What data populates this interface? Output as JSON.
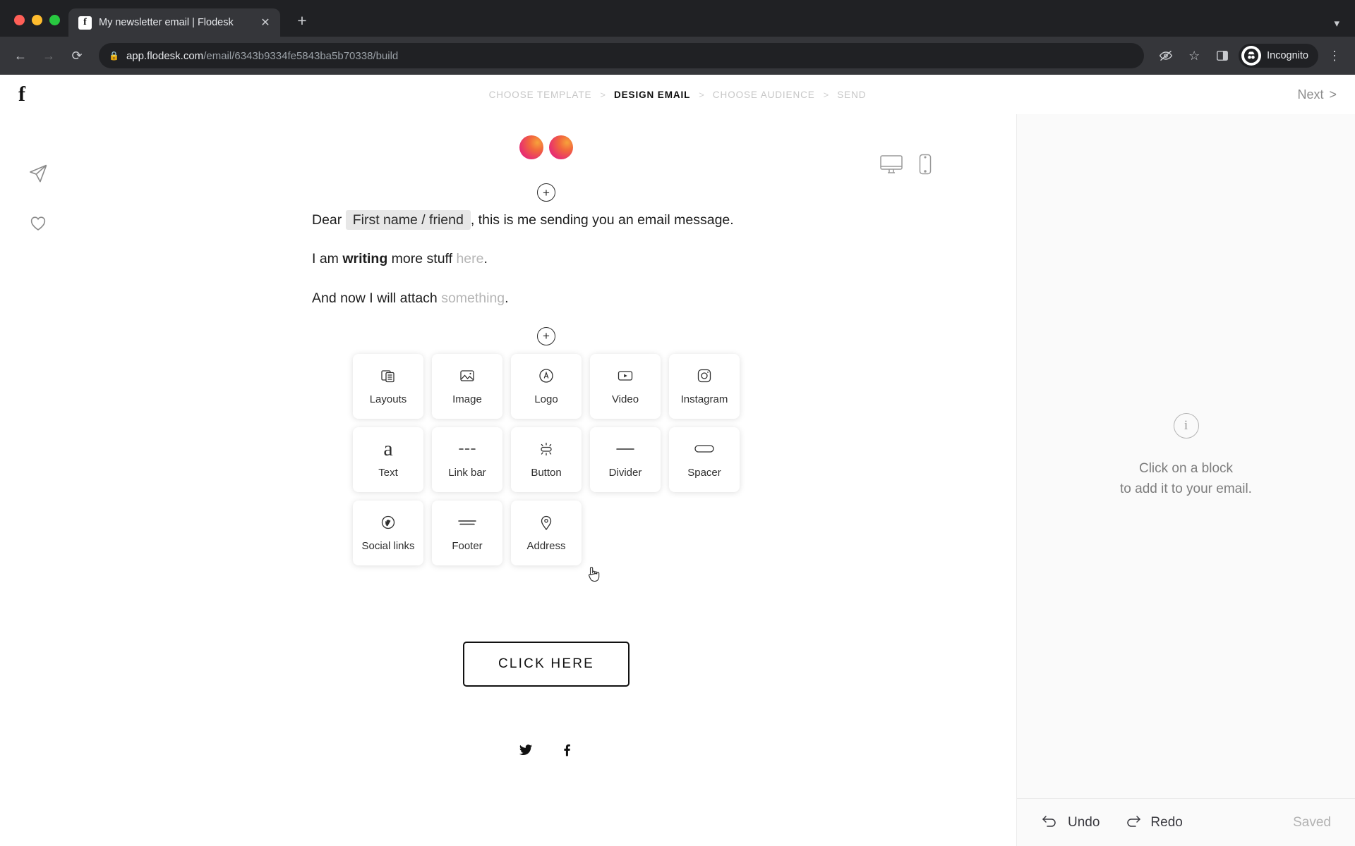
{
  "browser": {
    "tab": {
      "title": "My newsletter email | Flodesk",
      "favicon_letter": "f",
      "close_icon": "close-icon"
    },
    "new_tab_label": "+",
    "tab_list_chevron": "chevron-down-icon",
    "url_host": "app.flodesk.com",
    "url_path": "/email/6343b9334fe5843ba5b70338/build",
    "profile_label": "Incognito",
    "icons": {
      "back": "back-arrow-icon",
      "forward": "forward-arrow-icon",
      "reload": "reload-icon",
      "lock": "lock-icon",
      "tracking_protection": "eye-off-icon",
      "bookmark": "star-icon",
      "side_panel": "side-panel-icon",
      "menu": "three-dot-menu-icon"
    }
  },
  "app": {
    "brand_logo": "f",
    "steps": [
      {
        "label": "CHOOSE TEMPLATE",
        "active": false
      },
      {
        "label": "DESIGN EMAIL",
        "active": true
      },
      {
        "label": "CHOOSE AUDIENCE",
        "active": false
      },
      {
        "label": "SEND",
        "active": false
      }
    ],
    "step_separator": ">",
    "next_label": "Next",
    "next_chevron": ">",
    "left_rail": [
      {
        "name": "preview-send-icon"
      },
      {
        "name": "favorite-heart-icon"
      }
    ],
    "preview_toggles": [
      {
        "name": "desktop-preview-icon"
      },
      {
        "name": "mobile-preview-icon"
      }
    ]
  },
  "email": {
    "add_block_symbol": "+",
    "paragraph1": {
      "prefix": "Dear",
      "merge_tag": "First name / friend",
      "suffix": ", this is me sending you an email message."
    },
    "paragraph2": {
      "pre": "I am ",
      "bold": "writing",
      "mid": " more stuff ",
      "link": "here",
      "post": "."
    },
    "paragraph3": {
      "pre": "And now I will attach ",
      "link": "something",
      "post": "."
    },
    "cta_label": "CLICK HERE",
    "footer_social": [
      {
        "name": "twitter-icon"
      },
      {
        "name": "facebook-icon"
      }
    ]
  },
  "block_picker": {
    "rows": [
      [
        {
          "label": "Layouts",
          "icon": "layouts-icon"
        },
        {
          "label": "Image",
          "icon": "image-icon"
        },
        {
          "label": "Logo",
          "icon": "logo-icon"
        },
        {
          "label": "Video",
          "icon": "video-icon"
        },
        {
          "label": "Instagram",
          "icon": "instagram-icon"
        }
      ],
      [
        {
          "label": "Text",
          "icon": "text-icon"
        },
        {
          "label": "Link bar",
          "icon": "link-bar-icon"
        },
        {
          "label": "Button",
          "icon": "button-icon"
        },
        {
          "label": "Divider",
          "icon": "divider-icon"
        },
        {
          "label": "Spacer",
          "icon": "spacer-icon"
        }
      ],
      [
        {
          "label": "Social links",
          "icon": "social-links-icon"
        },
        {
          "label": "Footer",
          "icon": "footer-icon"
        },
        {
          "label": "Address",
          "icon": "address-icon"
        }
      ]
    ]
  },
  "right_panel": {
    "info_icon": "info-icon",
    "message_line1": "Click on a block",
    "message_line2": "to add it to your email.",
    "undo_label": "Undo",
    "redo_label": "Redo",
    "save_status": "Saved"
  }
}
